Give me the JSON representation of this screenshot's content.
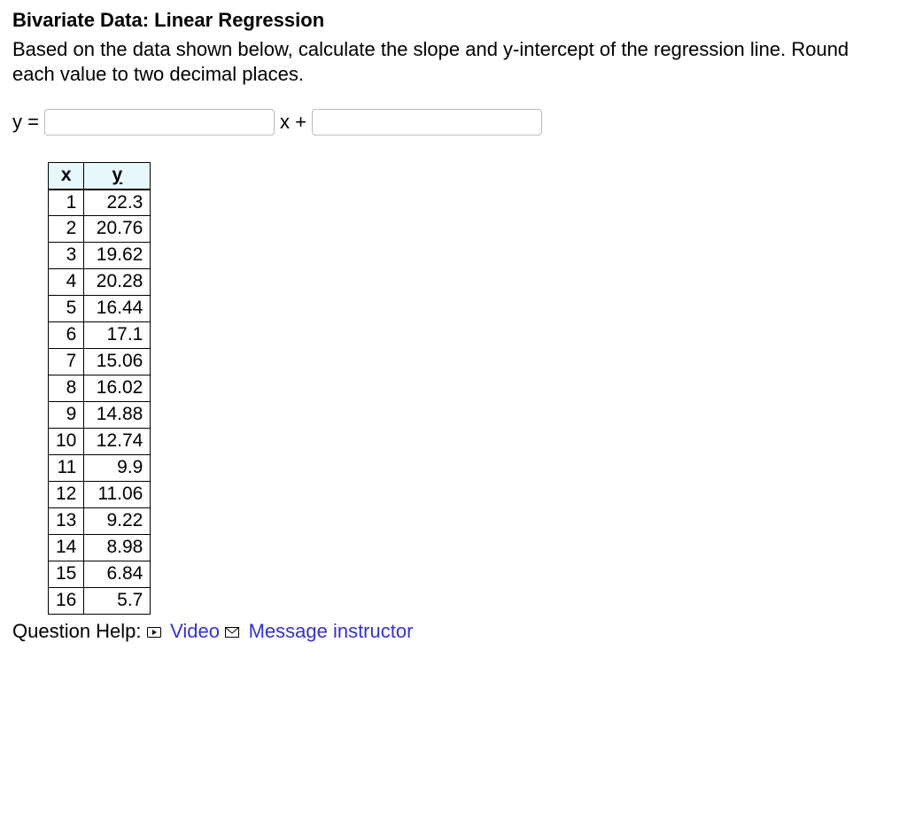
{
  "title": "Bivariate Data: Linear Regression",
  "instructions": "Based on the data shown below, calculate the slope and y-intercept of the regression line. Round each value to two decimal places.",
  "equation": {
    "prefix": "y =",
    "mid": "x +",
    "slope_value": "",
    "intercept_value": ""
  },
  "table": {
    "headers": {
      "x": "x",
      "y": "y"
    },
    "rows": [
      {
        "x": "1",
        "y": "22.3"
      },
      {
        "x": "2",
        "y": "20.76"
      },
      {
        "x": "3",
        "y": "19.62"
      },
      {
        "x": "4",
        "y": "20.28"
      },
      {
        "x": "5",
        "y": "16.44"
      },
      {
        "x": "6",
        "y": "17.1"
      },
      {
        "x": "7",
        "y": "15.06"
      },
      {
        "x": "8",
        "y": "16.02"
      },
      {
        "x": "9",
        "y": "14.88"
      },
      {
        "x": "10",
        "y": "12.74"
      },
      {
        "x": "11",
        "y": "9.9"
      },
      {
        "x": "12",
        "y": "11.06"
      },
      {
        "x": "13",
        "y": "9.22"
      },
      {
        "x": "14",
        "y": "8.98"
      },
      {
        "x": "15",
        "y": "6.84"
      },
      {
        "x": "16",
        "y": "5.7"
      }
    ]
  },
  "help": {
    "label": "Question Help:",
    "video": "Video",
    "message": "Message instructor"
  }
}
